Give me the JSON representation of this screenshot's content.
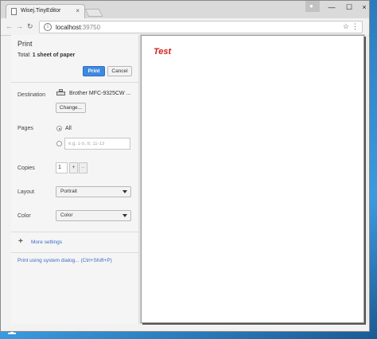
{
  "browser": {
    "tab_title": "Wisej.TinyEditor",
    "tab_close": "×",
    "url_host": "localhost",
    "url_port": ":39750",
    "window_min": "—",
    "window_max": "☐",
    "window_close": "×",
    "user_icon": "person-icon"
  },
  "print": {
    "title": "Print",
    "total_prefix": "Total: ",
    "total_value": "1 sheet of paper",
    "print_button": "Print",
    "cancel_button": "Cancel",
    "destination_label": "Destination",
    "destination_value": "Brother MFC-9325CW ...",
    "change_button": "Change...",
    "pages_label": "Pages",
    "pages_all": "All",
    "pages_placeholder": "e.g. 1-5, 8, 11-13",
    "copies_label": "Copies",
    "copies_value": "1",
    "copies_plus": "+",
    "copies_minus": "–",
    "layout_label": "Layout",
    "layout_value": "Portrait",
    "color_label": "Color",
    "color_value": "Color",
    "more_settings": "More settings",
    "system_dialog": "Print using system dialog... (Ctrl+Shift+P)"
  },
  "preview": {
    "text": "Test",
    "text_color": "#d42020"
  },
  "colors": {
    "accent": "#3f8ae0",
    "link": "#3b6cc5"
  }
}
